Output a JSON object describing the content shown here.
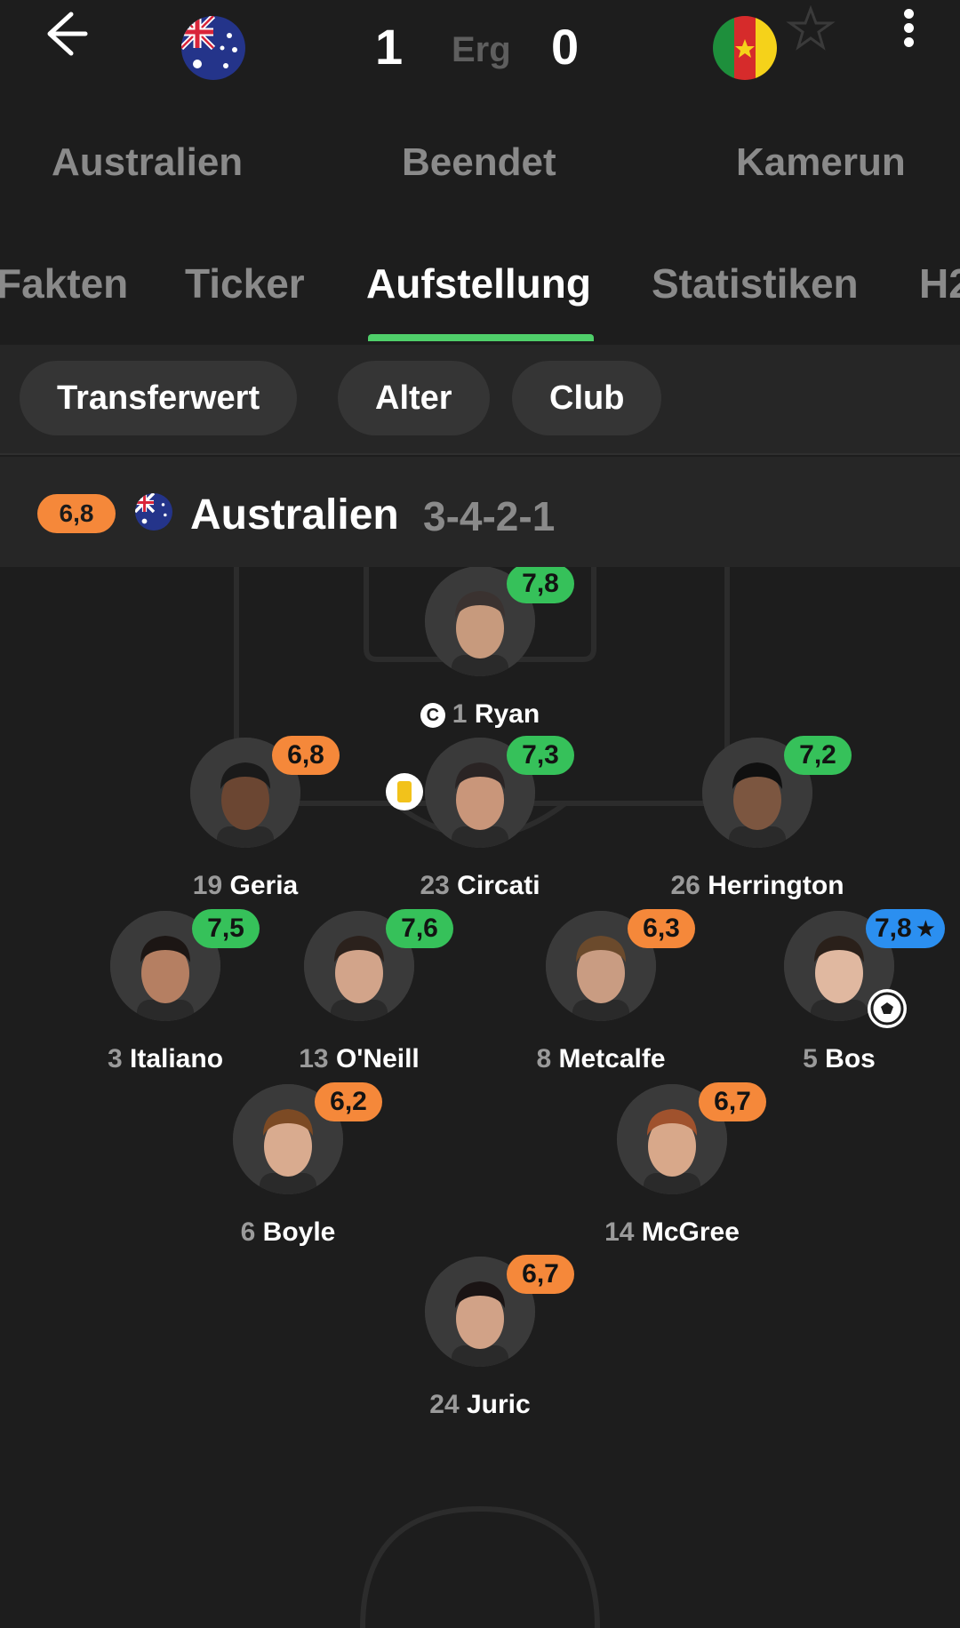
{
  "match": {
    "home_score": "1",
    "away_score": "0",
    "separator": "Erg",
    "home_team": "Australien",
    "away_team": "Kamerun",
    "status": "Beendet"
  },
  "tabs": [
    {
      "label": "Fakten"
    },
    {
      "label": "Ticker"
    },
    {
      "label": "Aufstellung"
    },
    {
      "label": "Statistiken"
    },
    {
      "label": "H2"
    }
  ],
  "chips": [
    {
      "label": "Transferwert"
    },
    {
      "label": "Alter"
    },
    {
      "label": "Club"
    }
  ],
  "team": {
    "rating": "6,8",
    "name": "Australien",
    "formation": "3-4-2-1"
  },
  "players": [
    {
      "number": "1",
      "name": "Ryan",
      "rating": "7,8",
      "rating_color": "green",
      "captain": true
    },
    {
      "number": "19",
      "name": "Geria",
      "rating": "6,8",
      "rating_color": "orange"
    },
    {
      "number": "23",
      "name": "Circati",
      "rating": "7,3",
      "rating_color": "green",
      "yellow_card": true
    },
    {
      "number": "26",
      "name": "Herrington",
      "rating": "7,2",
      "rating_color": "green"
    },
    {
      "number": "3",
      "name": "Italiano",
      "rating": "7,5",
      "rating_color": "green"
    },
    {
      "number": "13",
      "name": "O'Neill",
      "rating": "7,6",
      "rating_color": "green"
    },
    {
      "number": "8",
      "name": "Metcalfe",
      "rating": "6,3",
      "rating_color": "orange"
    },
    {
      "number": "5",
      "name": "Bos",
      "rating": "7,8",
      "rating_color": "blue",
      "player_of_match": true,
      "goal": true
    },
    {
      "number": "6",
      "name": "Boyle",
      "rating": "6,2",
      "rating_color": "orange"
    },
    {
      "number": "14",
      "name": "McGree",
      "rating": "6,7",
      "rating_color": "orange"
    },
    {
      "number": "24",
      "name": "Juric",
      "rating": "6,7",
      "rating_color": "orange"
    }
  ],
  "icons": {
    "back": "arrow-left-icon",
    "favorite": "star-outline-icon",
    "more": "more-vertical-icon",
    "captain": "captain-icon",
    "yellow_card": "yellow-card-icon",
    "goal": "soccer-ball-icon",
    "player_of_match": "star-icon"
  },
  "colors": {
    "background": "#1d1d1d",
    "accent": "#4fcf6a",
    "rating_green": "#36c15a",
    "rating_orange": "#f5883a",
    "rating_blue": "#2b8ff0"
  }
}
